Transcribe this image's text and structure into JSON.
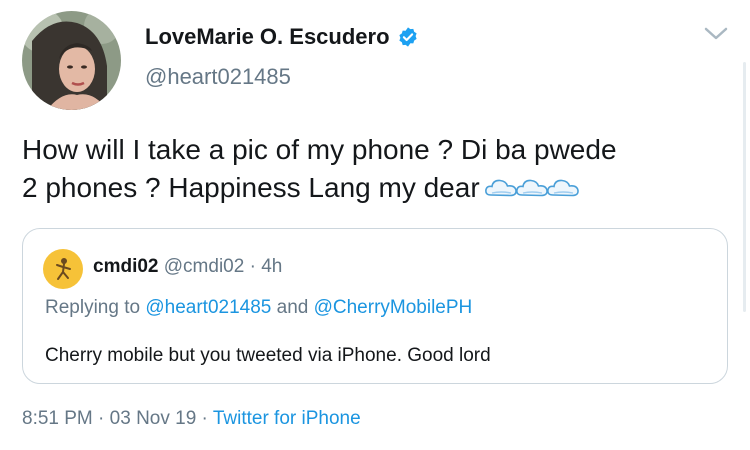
{
  "author": {
    "name": "LoveMarie O. Escudero",
    "handle": "@heart021485",
    "verified_icon": "verified-badge-icon",
    "badge_color": "#1da1f2"
  },
  "tweet": {
    "text_line1": "How will I take a pic of my phone ? Di ba pwede",
    "text_line2": "2 phones ? Happiness Lang my dear",
    "emoji": [
      "cloud-icon",
      "cloud-icon",
      "cloud-icon"
    ]
  },
  "quoted": {
    "name": "cmdi02",
    "handle": "@cmdi02",
    "separator": " · ",
    "age": "4h",
    "reply_prefix": "Replying to ",
    "reply_user1": "@heart021485",
    "reply_and": " and ",
    "reply_user2": "@CherryMobilePH",
    "text": "Cherry mobile but you tweeted via iPhone. Good lord"
  },
  "meta": {
    "time": "8:51 PM",
    "separator": " · ",
    "date": "03 Nov 19",
    "separator2": " · ",
    "source": "Twitter for iPhone"
  },
  "colors": {
    "link": "#1b95e0",
    "muted": "#657786",
    "text": "#14171a",
    "border": "#ccd6dd"
  }
}
